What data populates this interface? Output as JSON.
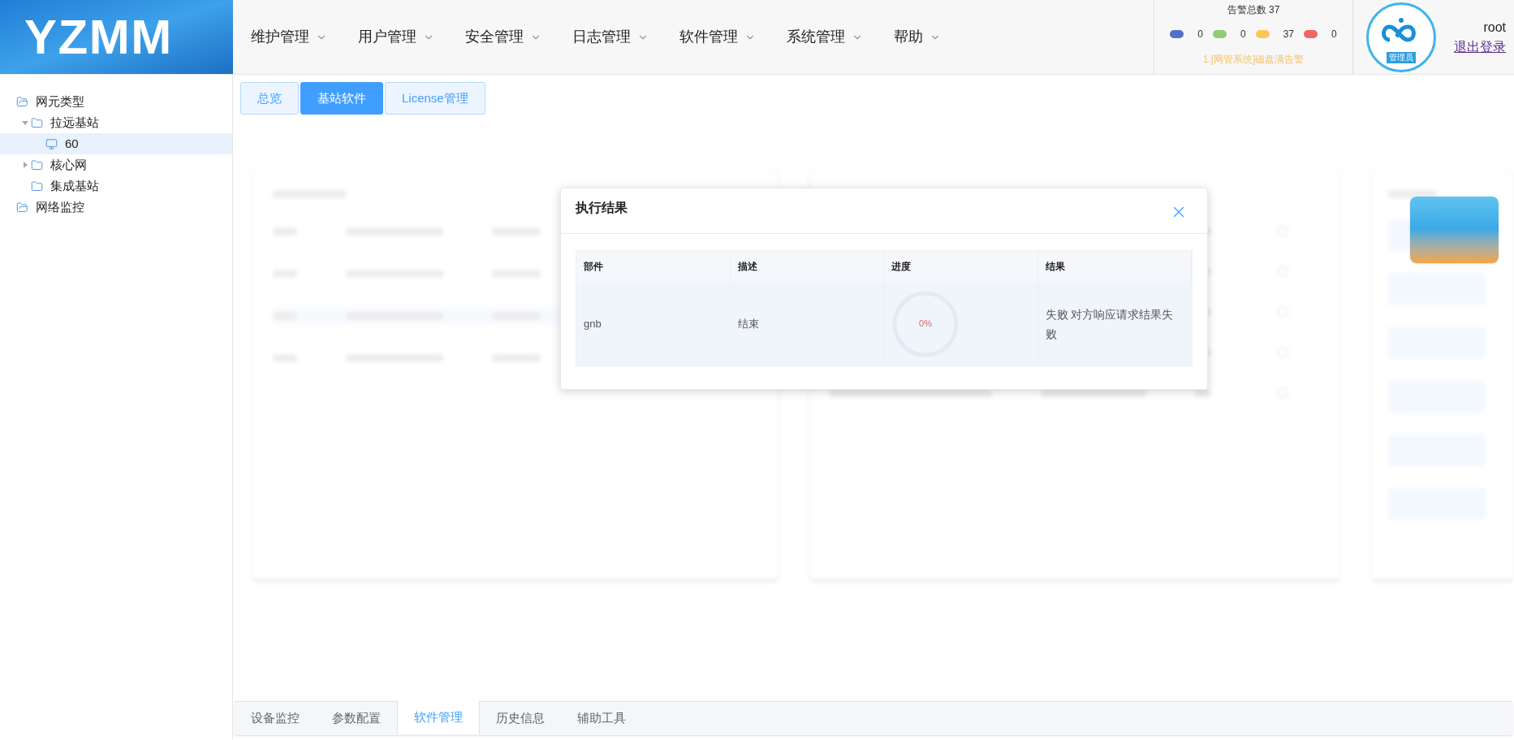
{
  "header": {
    "logo": "YZMM",
    "nav": [
      {
        "label": "维护管理"
      },
      {
        "label": "用户管理"
      },
      {
        "label": "安全管理"
      },
      {
        "label": "日志管理"
      },
      {
        "label": "软件管理"
      },
      {
        "label": "系统管理"
      },
      {
        "label": "帮助"
      }
    ],
    "alarms": {
      "title": "告警总数 37",
      "counts": [
        {
          "color": "#5470c6",
          "count": "0"
        },
        {
          "color": "#91cc75",
          "count": "0"
        },
        {
          "color": "#fac858",
          "count": "37"
        },
        {
          "color": "#ee6666",
          "count": "0"
        }
      ],
      "latest": "1.[网管系统]磁盘满告警"
    },
    "user": {
      "badge": "管理员",
      "name": "root",
      "logout": "退出登录"
    }
  },
  "sidebar": {
    "tree": [
      {
        "label": "网元类型",
        "kind": "open-folder",
        "selected": false,
        "children": [
          {
            "label": "拉远基站",
            "kind": "folder",
            "expanded": true,
            "selected": false,
            "children": [
              {
                "label": "60",
                "kind": "device",
                "selected": true
              }
            ]
          },
          {
            "label": "核心网",
            "kind": "folder",
            "expanded": false,
            "selected": false
          },
          {
            "label": "集成基站",
            "kind": "folder",
            "selected": false
          }
        ]
      },
      {
        "label": "网络监控",
        "kind": "open-folder",
        "selected": false
      }
    ]
  },
  "tabs": [
    {
      "label": "总览",
      "selected": false
    },
    {
      "label": "基站软件",
      "selected": true
    },
    {
      "label": "License管理",
      "selected": false
    }
  ],
  "dialog": {
    "title": "执行结果",
    "columns": [
      "部件",
      "描述",
      "进度",
      "结果"
    ],
    "rows": [
      {
        "part": "gnb",
        "description": "结束",
        "progress": "0%",
        "result": "失败 对方响应请求结果失败"
      }
    ]
  },
  "bottom_tabs": [
    {
      "label": "设备监控",
      "selected": false
    },
    {
      "label": "参数配置",
      "selected": false
    },
    {
      "label": "软件管理",
      "selected": true
    },
    {
      "label": "历史信息",
      "selected": false
    },
    {
      "label": "辅助工具",
      "selected": false
    }
  ]
}
